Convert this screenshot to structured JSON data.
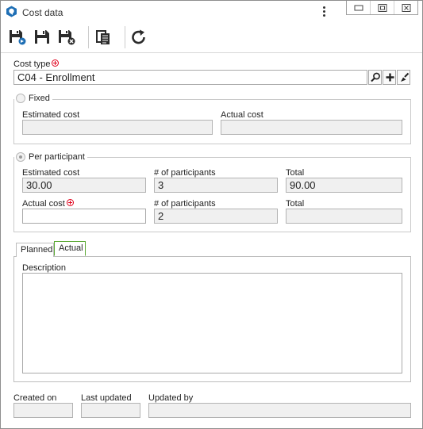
{
  "window": {
    "title": "Cost data",
    "controls": [
      "minimize-icon",
      "restore-icon",
      "close-icon"
    ]
  },
  "toolbar": {
    "buttons": [
      "save-and-new-icon",
      "save-icon",
      "save-and-close-icon",
      "copy-icon",
      "refresh-icon"
    ]
  },
  "cost_type": {
    "label": "Cost type",
    "value": "C04 - Enrollment",
    "buttons": [
      "search-icon",
      "add-icon",
      "clear-icon"
    ]
  },
  "fixed": {
    "legend": "Fixed",
    "selected": false,
    "estimated_label": "Estimated cost",
    "estimated_value": "",
    "actual_label": "Actual cost",
    "actual_value": ""
  },
  "per_participant": {
    "legend": "Per participant",
    "selected": true,
    "estimated_label": "Estimated cost",
    "estimated_value": "30.00",
    "participants_label_1": "# of participants",
    "participants_value_1": "3",
    "total_label_1": "Total",
    "total_value_1": "90.00",
    "actual_label": "Actual cost",
    "actual_value": "",
    "participants_label_2": "# of participants",
    "participants_value_2": "2",
    "total_label_2": "Total",
    "total_value_2": ""
  },
  "tabs": {
    "items": [
      "Planned",
      "Actual"
    ],
    "active": "Actual",
    "description_label": "Description",
    "description_value": ""
  },
  "footer": {
    "created_label": "Created on",
    "created_value": "",
    "updated_label": "Last updated",
    "updated_value": "",
    "updated_by_label": "Updated by",
    "updated_by_value": ""
  },
  "colors": {
    "accent": "#1f6fb5",
    "required": "#e0001b",
    "active_tab_border": "#5aa832"
  }
}
